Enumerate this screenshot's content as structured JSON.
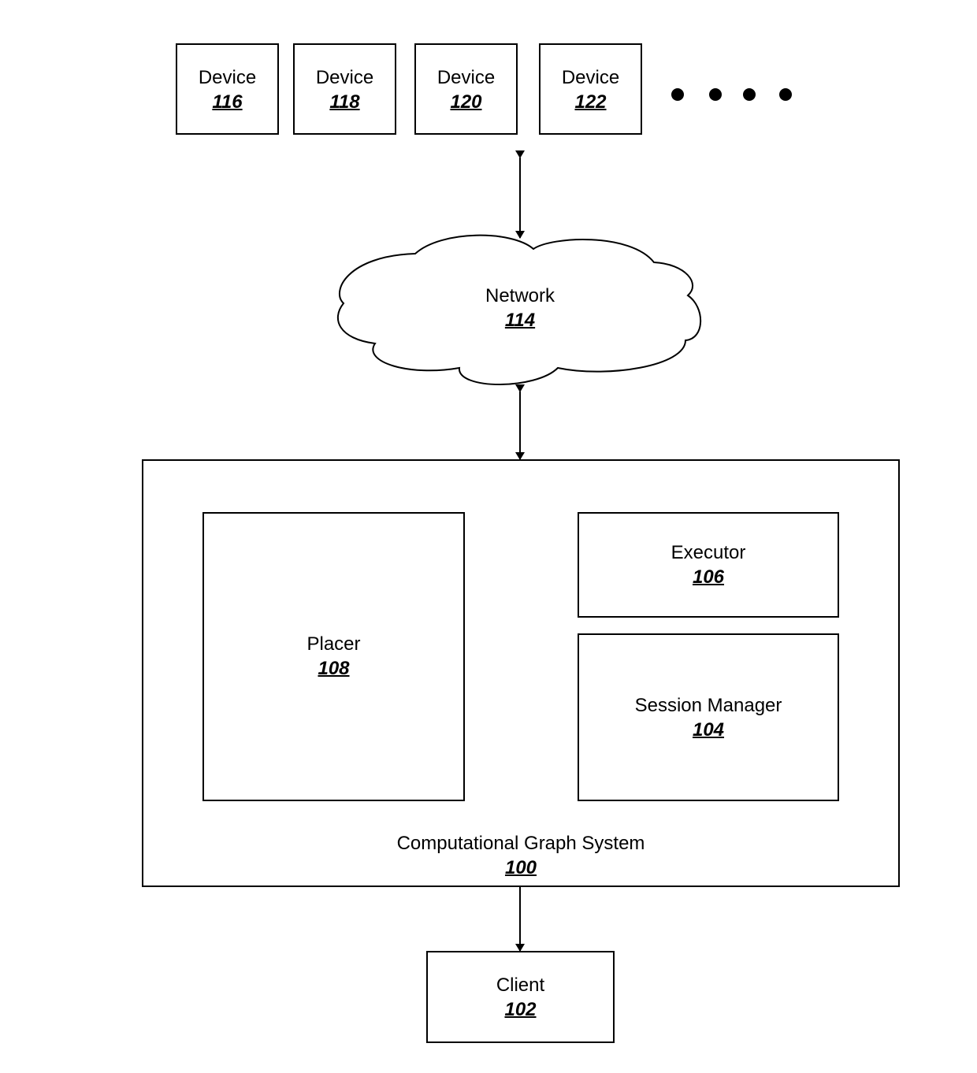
{
  "devices": [
    {
      "label": "Device",
      "ref": "116"
    },
    {
      "label": "Device",
      "ref": "118"
    },
    {
      "label": "Device",
      "ref": "120"
    },
    {
      "label": "Device",
      "ref": "122"
    }
  ],
  "ellipsis_icon": "four-dots",
  "network": {
    "label": "Network",
    "ref": "114"
  },
  "system": {
    "label": "Computational Graph System",
    "ref": "100"
  },
  "placer": {
    "label": "Placer",
    "ref": "108"
  },
  "executor": {
    "label": "Executor",
    "ref": "106"
  },
  "session_manager": {
    "label": "Session Manager",
    "ref": "104"
  },
  "client": {
    "label": "Client",
    "ref": "102"
  }
}
